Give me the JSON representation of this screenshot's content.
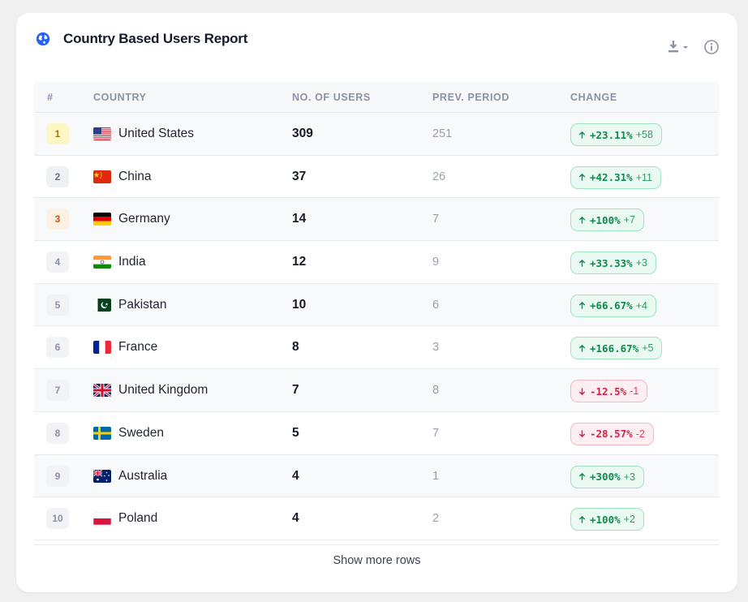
{
  "card": {
    "title": "Country Based Users Report",
    "show_more_label": "Show more rows"
  },
  "table": {
    "headers": {
      "rank": "#",
      "country": "COUNTRY",
      "users": "NO. OF USERS",
      "prev": "PREV. PERIOD",
      "change": "CHANGE"
    },
    "rows": [
      {
        "rank": "1",
        "country": "United States",
        "flag": "us-flag",
        "users": "309",
        "prev": "251",
        "pct": "+23.11%",
        "delta": "+58",
        "trend": "up"
      },
      {
        "rank": "2",
        "country": "China",
        "flag": "cn-flag",
        "users": "37",
        "prev": "26",
        "pct": "+42.31%",
        "delta": "+11",
        "trend": "up"
      },
      {
        "rank": "3",
        "country": "Germany",
        "flag": "de-flag",
        "users": "14",
        "prev": "7",
        "pct": "+100%",
        "delta": "+7",
        "trend": "up"
      },
      {
        "rank": "4",
        "country": "India",
        "flag": "in-flag",
        "users": "12",
        "prev": "9",
        "pct": "+33.33%",
        "delta": "+3",
        "trend": "up"
      },
      {
        "rank": "5",
        "country": "Pakistan",
        "flag": "pk-flag",
        "users": "10",
        "prev": "6",
        "pct": "+66.67%",
        "delta": "+4",
        "trend": "up"
      },
      {
        "rank": "6",
        "country": "France",
        "flag": "fr-flag",
        "users": "8",
        "prev": "3",
        "pct": "+166.67%",
        "delta": "+5",
        "trend": "up"
      },
      {
        "rank": "7",
        "country": "United Kingdom",
        "flag": "gb-flag",
        "users": "7",
        "prev": "8",
        "pct": "-12.5%",
        "delta": "-1",
        "trend": "down"
      },
      {
        "rank": "8",
        "country": "Sweden",
        "flag": "se-flag",
        "users": "5",
        "prev": "7",
        "pct": "-28.57%",
        "delta": "-2",
        "trend": "down"
      },
      {
        "rank": "9",
        "country": "Australia",
        "flag": "au-flag",
        "users": "4",
        "prev": "1",
        "pct": "+300%",
        "delta": "+3",
        "trend": "up"
      },
      {
        "rank": "10",
        "country": "Poland",
        "flag": "pl-flag",
        "users": "4",
        "prev": "2",
        "pct": "+100%",
        "delta": "+2",
        "trend": "up"
      }
    ]
  },
  "icons": {
    "title_icon": "globe-icon",
    "download": "download-icon",
    "info": "info-icon"
  },
  "colors": {
    "accent": "#2563eb",
    "positive": "#0e8a4d",
    "negative": "#d61f48"
  }
}
